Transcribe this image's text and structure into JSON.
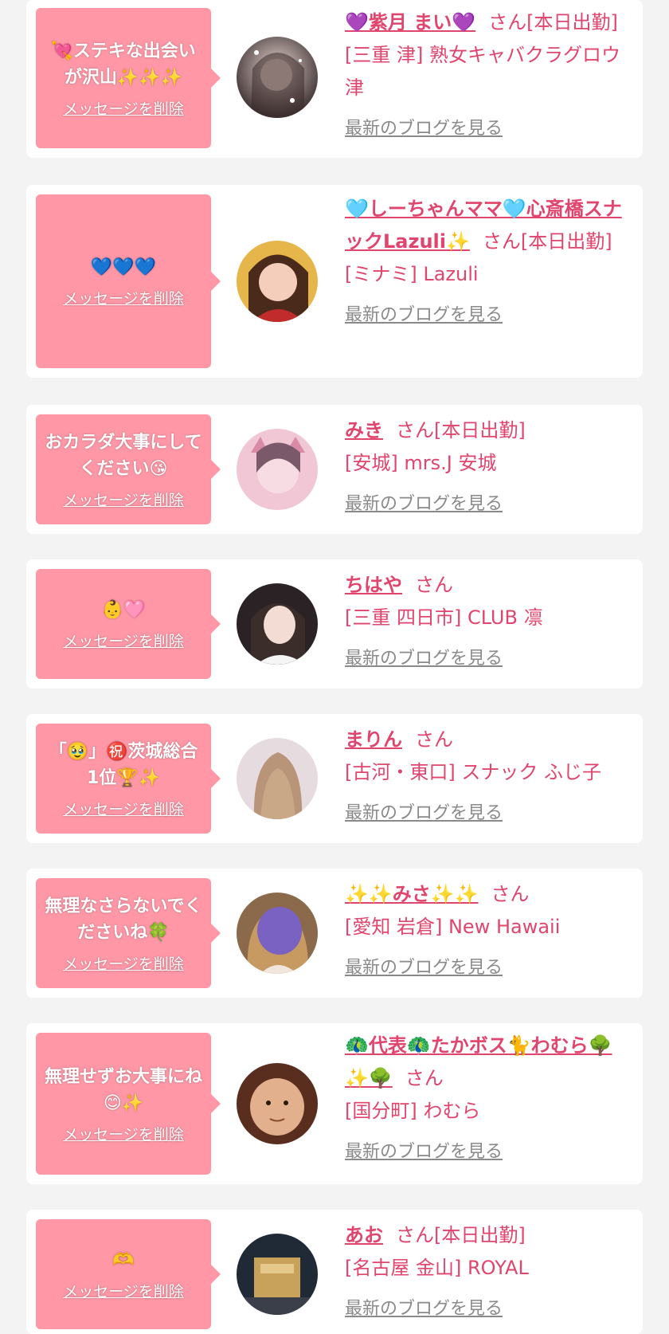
{
  "colors": {
    "bubble": "#ff97a6",
    "accent": "#e0456e",
    "link_gray": "#8a8a8a",
    "card": "#ffffff",
    "background": "#f3f3f3"
  },
  "cards": [
    {
      "message": "💘ステキな出会いが沢山✨✨✨",
      "delete_label": "メッセージを削除",
      "name": "💜紫月 まい💜",
      "suffix": "さん[本日出勤]",
      "shop": "[三重 津] 熟女キャバクラグロウ津",
      "blog_label": "最新のブログを見る",
      "avatar_icon": "avatar-photo"
    },
    {
      "message": "💙💙💙",
      "delete_label": "メッセージを削除",
      "name": "🩵しーちゃんママ🩵心斎橋スナックLazuli✨",
      "suffix": "さん[本日出勤]",
      "shop": "[ミナミ] Lazuli",
      "blog_label": "最新のブログを見る",
      "avatar_icon": "avatar-photo"
    },
    {
      "message": "おカラダ大事にしてください😘",
      "delete_label": "メッセージを削除",
      "name": "みき",
      "suffix": "さん[本日出勤]",
      "shop": "[安城] mrs.J 安城",
      "blog_label": "最新のブログを見る",
      "avatar_icon": "avatar-photo"
    },
    {
      "message": "👶🩷",
      "delete_label": "メッセージを削除",
      "name": "ちはや",
      "suffix": "さん",
      "shop": "[三重 四日市] CLUB 凛",
      "blog_label": "最新のブログを見る",
      "avatar_icon": "avatar-photo"
    },
    {
      "message": "「🥹」㊗️茨城総合1位🏆✨",
      "delete_label": "メッセージを削除",
      "name": "まりん",
      "suffix": "さん",
      "shop": "[古河・東口] スナック ふじ子",
      "blog_label": "最新のブログを見る",
      "avatar_icon": "avatar-photo"
    },
    {
      "message": "無理なさらないでくださいね🍀",
      "delete_label": "メッセージを削除",
      "name": "✨✨みさ✨✨",
      "suffix": "さん",
      "shop": "[愛知 岩倉] New Hawaii",
      "blog_label": "最新のブログを見る",
      "avatar_icon": "avatar-photo"
    },
    {
      "message": "無理せずお大事にね😊✨",
      "delete_label": "メッセージを削除",
      "name": "🦚代表🦚たかボス🐈わむら🌳✨🌳",
      "suffix": "さん",
      "shop": "[国分町] わむら",
      "blog_label": "最新のブログを見る",
      "avatar_icon": "avatar-photo"
    },
    {
      "message": "🫶",
      "delete_label": "メッセージを削除",
      "name": "あお",
      "suffix": "さん[本日出勤]",
      "shop": "[名古屋 金山] ROYAL",
      "blog_label": "最新のブログを見る",
      "avatar_icon": "avatar-photo"
    }
  ]
}
